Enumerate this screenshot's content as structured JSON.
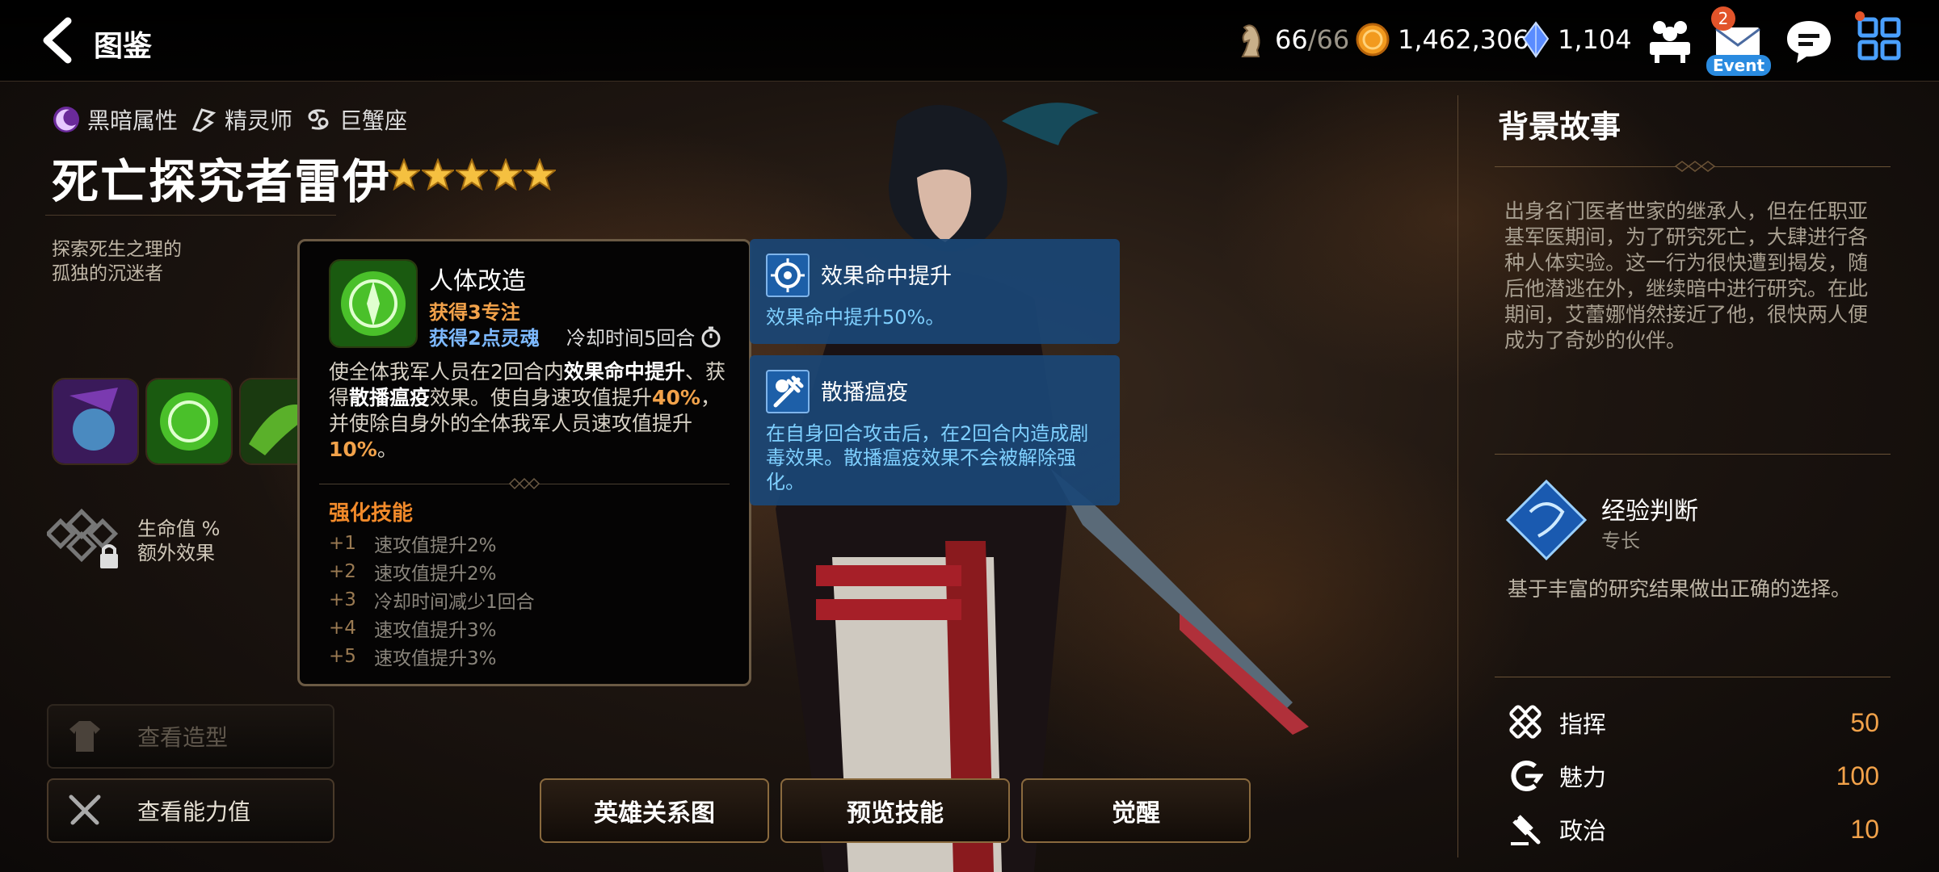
{
  "header": {
    "title": "图鉴",
    "resources": [
      {
        "name": "stamina",
        "value": "66",
        "max": "/66"
      },
      {
        "name": "gold",
        "value": "1,462,306"
      },
      {
        "name": "crystal",
        "value": "1,104"
      }
    ],
    "mail_badge": "2",
    "event_label": "Event"
  },
  "hero": {
    "attributes": [
      "黑暗属性",
      "精灵师",
      "巨蟹座"
    ],
    "name": "死亡探究者雷伊",
    "subtitle": "探索死生之理的\n孤独的沉迷者",
    "bonus": "生命值 %\n额外效果"
  },
  "skill_tooltip": {
    "name": "人体改造",
    "focus": "获得3专注",
    "soul": "获得2点灵魂",
    "cooldown": "冷却时间5回合",
    "desc": {
      "p1": "使全体我军人员在2回合内",
      "p2": "效果命中提升",
      "p3": "、获得",
      "p4": "散播瘟疫",
      "p5": "效果。使自身速攻值提升",
      "p6": "40%",
      "p7": "，并使除自身外的全体我军人员速攻值提升",
      "p8": "10%",
      "p9": "。"
    },
    "enhance_title": "强化技能",
    "enhancements": [
      {
        "level": "+1",
        "text": "速攻值提升2%"
      },
      {
        "level": "+2",
        "text": "速攻值提升2%"
      },
      {
        "level": "+3",
        "text": "冷却时间减少1回合"
      },
      {
        "level": "+4",
        "text": "速攻值提升3%"
      },
      {
        "level": "+5",
        "text": "速攻值提升3%"
      }
    ]
  },
  "buffs": [
    {
      "title": "效果命中提升",
      "desc": "效果命中提升50%。"
    },
    {
      "title": "散播瘟疫",
      "desc": "在自身回合攻击后，在2回合内造成剧毒效果。散播瘟疫效果不会被解除强化。"
    }
  ],
  "buttons": {
    "view_costume": "查看造型",
    "view_stats": "查看能力值",
    "relationship": "英雄关系图",
    "preview_skill": "预览技能",
    "awaken": "觉醒"
  },
  "right_panel": {
    "title": "背景故事",
    "story": "出身名门医者世家的继承人，但在任职亚基军医期间，为了研究死亡，大肆进行各种人体实验。这一行为很快遭到揭发，随后他潜逃在外，继续暗中进行研究。在此期间，艾蕾娜悄然接近了他，很快两人便成为了奇妙的伙伴。",
    "specialty": {
      "name": "经验判断",
      "type": "专长",
      "desc": "基于丰富的研究结果做出正确的选择。"
    },
    "stats": [
      {
        "label": "指挥",
        "value": "50"
      },
      {
        "label": "魅力",
        "value": "100"
      },
      {
        "label": "政治",
        "value": "10"
      }
    ]
  },
  "colors": {
    "accent_orange": "#f2a24a",
    "buff_blue": "#1a4676",
    "buff_text": "#7fd0ff",
    "soul_blue": "#7db9ff"
  }
}
